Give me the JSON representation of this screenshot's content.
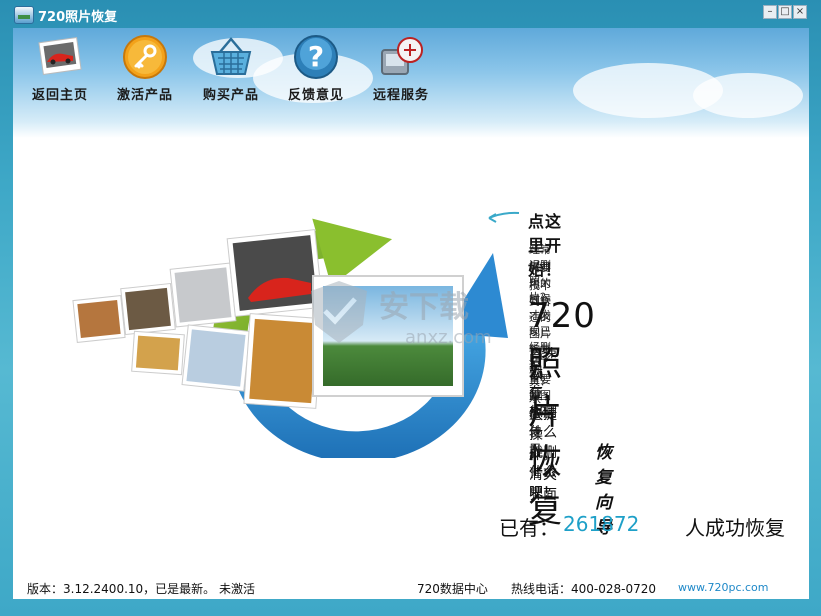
{
  "window": {
    "title": "720照片恢复",
    "controls": [
      "minimize-icon",
      "maximize-icon",
      "close-icon"
    ]
  },
  "toolbar": {
    "items": [
      {
        "label": "返回主页",
        "icon": "car-photo-icon"
      },
      {
        "label": "激活产品",
        "icon": "key-icon"
      },
      {
        "label": "购买产品",
        "icon": "shopping-basket-icon"
      },
      {
        "label": "反馈意见",
        "icon": "question-icon"
      },
      {
        "label": "远程服务",
        "icon": "remote-service-icon"
      }
    ]
  },
  "main": {
    "start_link": "点这里开始！",
    "questions": [
      "经常误删照片？",
      "需要用的时候才发现已经删掉了重要的图片？",
      "找不到合适的图片恢复工具？"
    ],
    "brand": "720照片恢复",
    "desc": [
      "高速恢复，快捷操作，清爽界面",
      "现在，想删什么就删什么吧！"
    ],
    "welcome": "欢迎使用",
    "wizard": "恢复向导",
    "count_prefix": "已有：",
    "count": "261872",
    "count_suffix": "人成功恢复"
  },
  "status": {
    "version": "版本：3.12.2400.10，已是最新。",
    "activation": "未激活",
    "center": "720数据中心",
    "hotline": "热线电话：400-028-0720",
    "site": "www.720pc.com"
  },
  "watermark": {
    "text": "安下载",
    "site": "anxz.com"
  },
  "colors": {
    "accent": "#1ea0c8",
    "frame": "#3ea8c7",
    "link": "#1e88c8"
  }
}
